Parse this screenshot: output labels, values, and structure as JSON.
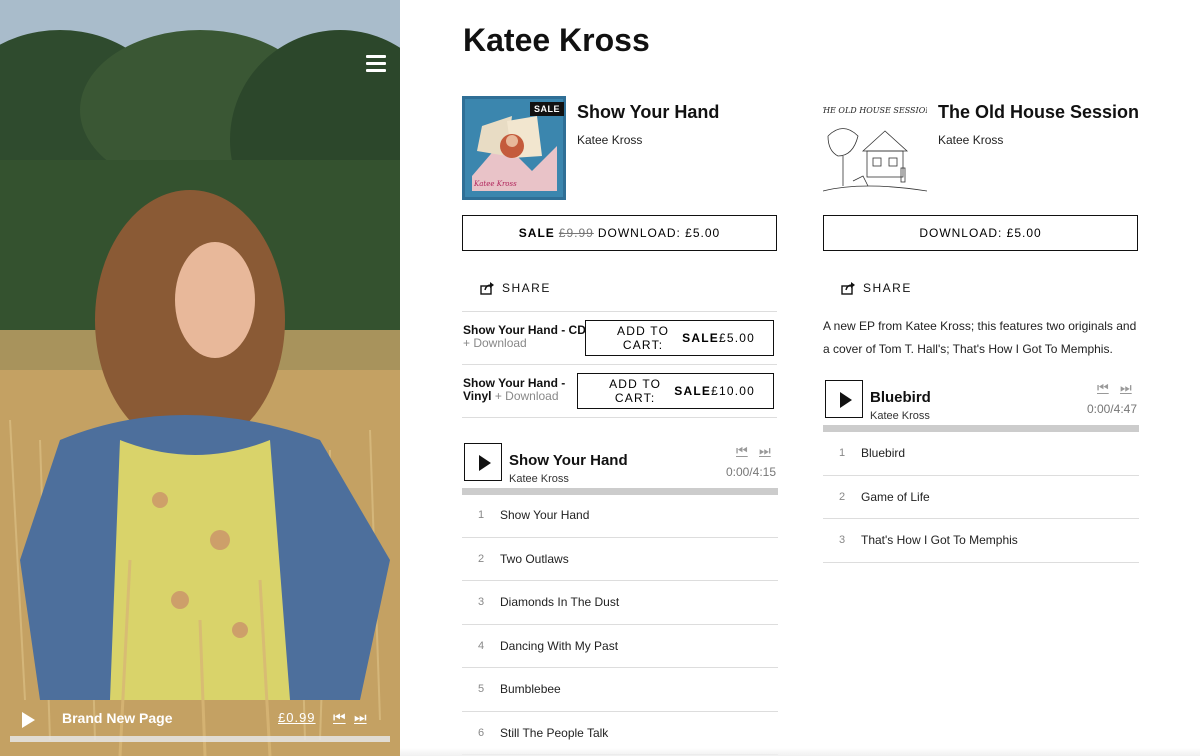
{
  "hero": {
    "menu_icon": "hamburger-icon",
    "mini_player": {
      "title": "Brand New Page",
      "price": "£0.99",
      "play_icon": "play-icon",
      "prev_symbol": "⏮",
      "next_symbol": "⏭"
    }
  },
  "artist_name": "Katee Kross",
  "albums": [
    {
      "title": "Show Your Hand",
      "artist": "Katee Kross",
      "sale_badge": "SALE",
      "buy": {
        "sale": "SALE",
        "old_price": "£9.99",
        "label": "DOWNLOAD: £5.00"
      },
      "share_label": "SHARE",
      "merch": [
        {
          "name": "Show Your Hand - CD",
          "plus": "+ Download",
          "btn_prefix": "ADD TO CART: ",
          "btn_sale": "SALE",
          "btn_price": "£5.00"
        },
        {
          "name": "Show Your Hand - Vinyl",
          "plus": "+ Download",
          "btn_prefix": "ADD TO CART: ",
          "btn_sale": "SALE",
          "btn_price": "£10.00"
        }
      ],
      "player": {
        "title": "Show Your Hand",
        "artist": "Katee Kross",
        "time": "0:00/4:15",
        "prev_symbol": "⏮",
        "next_symbol": "⏭"
      },
      "tracks": [
        {
          "n": "1",
          "title": "Show Your Hand"
        },
        {
          "n": "2",
          "title": "Two Outlaws"
        },
        {
          "n": "3",
          "title": "Diamonds In The Dust"
        },
        {
          "n": "4",
          "title": "Dancing With My Past"
        },
        {
          "n": "5",
          "title": "Bumblebee"
        },
        {
          "n": "6",
          "title": "Still The People Talk"
        }
      ]
    },
    {
      "title": "The Old House Session",
      "artist": "Katee Kross",
      "buy": {
        "label": "DOWNLOAD: £5.00"
      },
      "share_label": "SHARE",
      "description": "A new EP from Katee Kross; this features two originals and a cover of Tom T. Hall's; That's How I Got To Memphis.",
      "cover_text": "THE OLD HOUSE SESSION",
      "player": {
        "title": "Bluebird",
        "artist": "Katee Kross",
        "time": "0:00/4:47",
        "prev_symbol": "⏮",
        "next_symbol": "⏭"
      },
      "tracks": [
        {
          "n": "1",
          "title": "Bluebird"
        },
        {
          "n": "2",
          "title": "Game of Life"
        },
        {
          "n": "3",
          "title": "That's How I Got To Memphis"
        }
      ]
    }
  ],
  "colors": {
    "text": "#111111",
    "border": "#dddddd",
    "progress": "#cccccc",
    "muted": "#888888"
  }
}
